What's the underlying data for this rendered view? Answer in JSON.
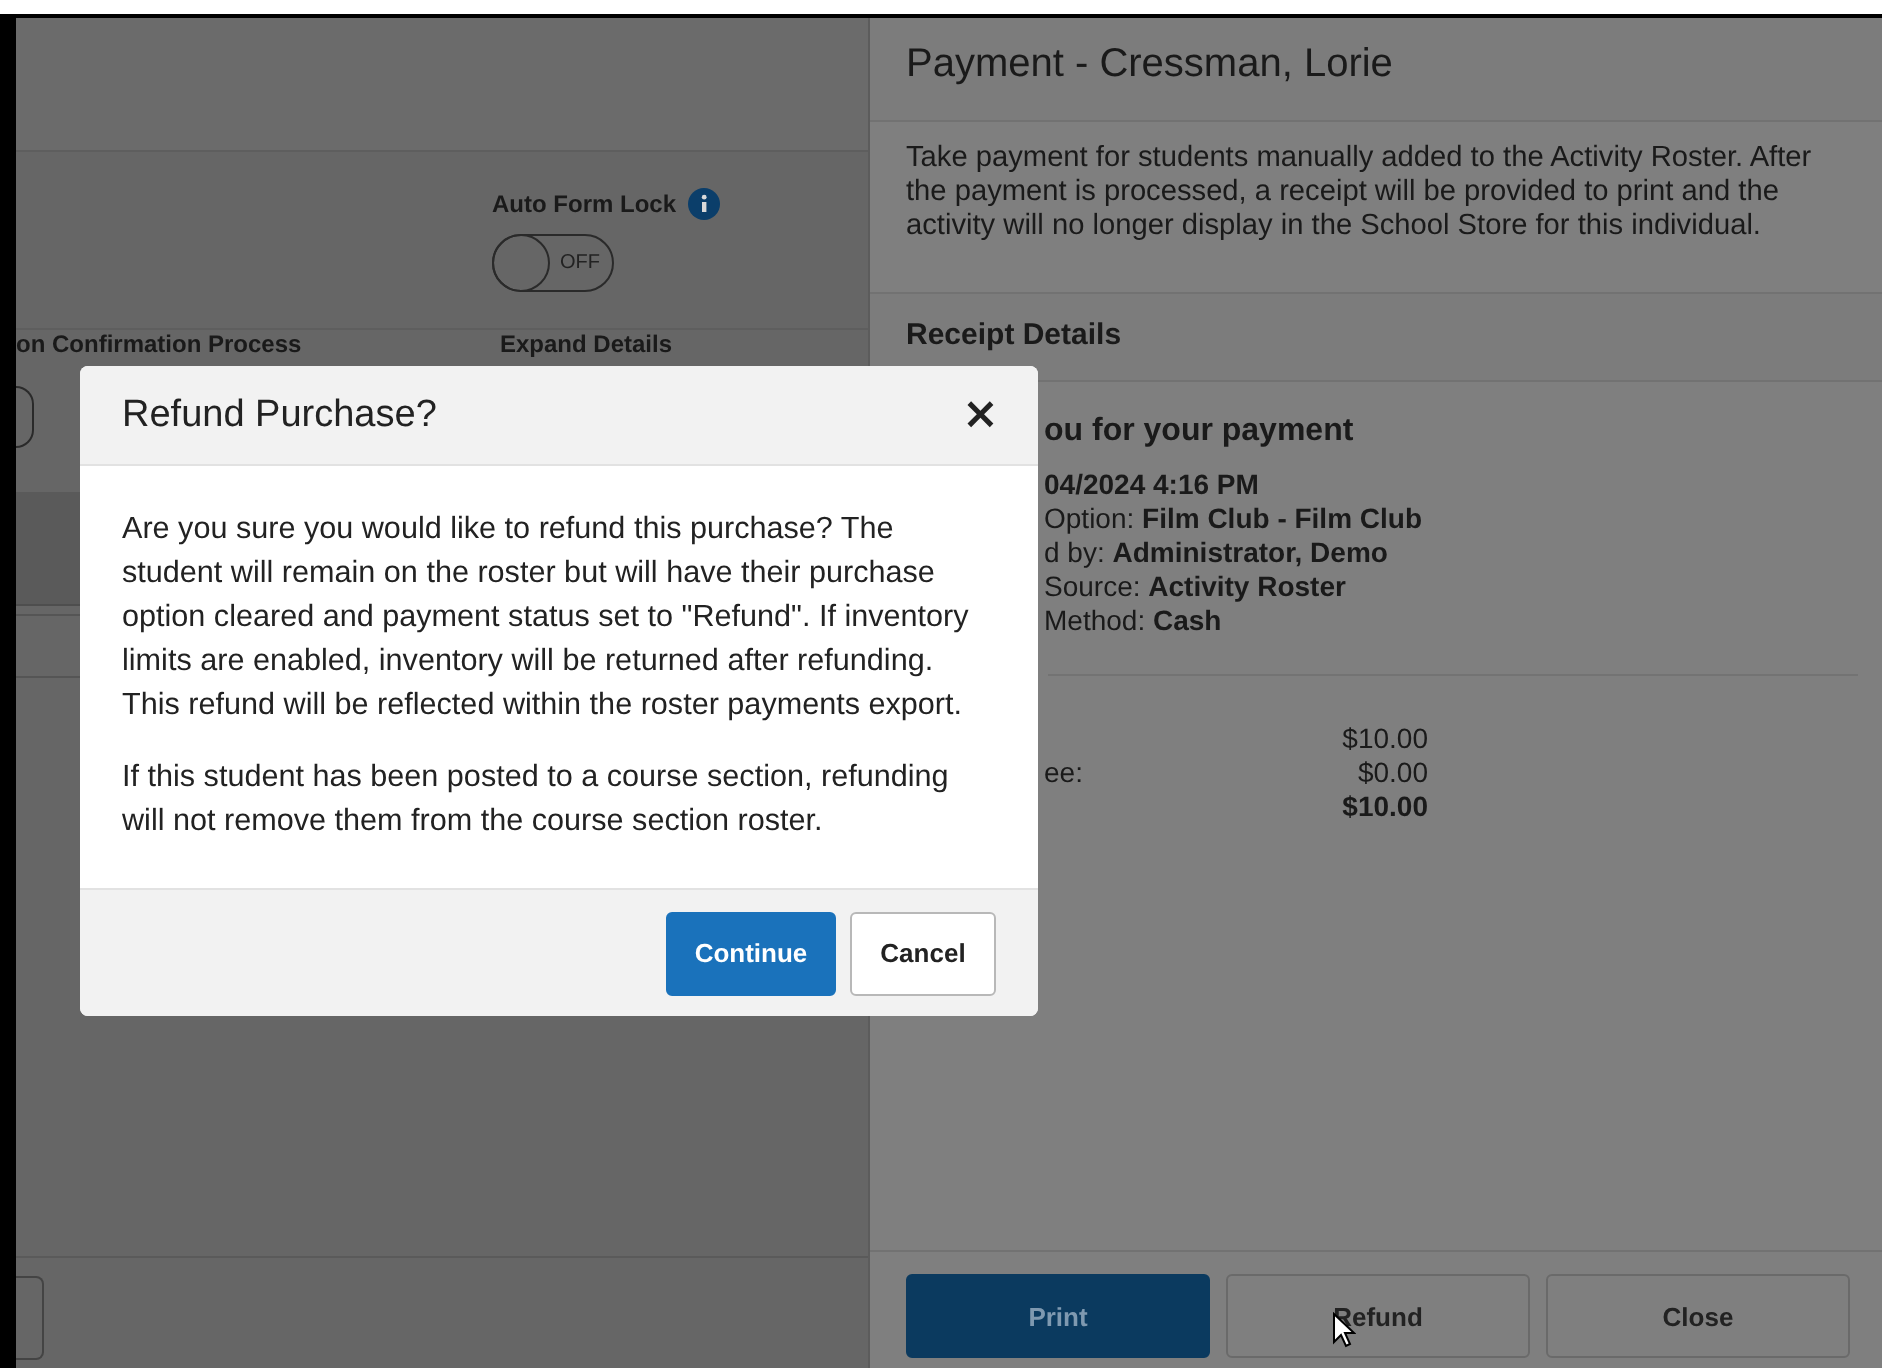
{
  "background_page": {
    "auto_form_lock": {
      "label": "Auto Form Lock",
      "toggle": {
        "on": false,
        "label": "OFF"
      }
    },
    "column_labels": [
      "on Confirmation Process",
      "Expand Details"
    ],
    "partial_toggle": {
      "on": false
    }
  },
  "payment_panel": {
    "title": "Payment - Cressman, Lorie",
    "description": "Take payment for students manually added to the Activity Roster. After the payment is processed, a receipt will be provided to print and the activity will no longer display in the School Store for this individual.",
    "section_title": "Receipt Details",
    "receipt": {
      "heading": "ou for your payment",
      "date": "04/2024 4:16 PM",
      "lines": [
        {
          "label": "Option:",
          "value": "Film Club - Film Club"
        },
        {
          "label": "d by:",
          "value": "Administrator, Demo"
        },
        {
          "label": "Source:",
          "value": "Activity Roster"
        },
        {
          "label": "Method:",
          "value": "Cash"
        }
      ],
      "amounts": [
        {
          "value": "$10.00",
          "bold": false
        },
        {
          "label": "ee:",
          "value": "$0.00",
          "bold": false
        },
        {
          "value": "$10.00",
          "bold": true
        }
      ]
    },
    "buttons": [
      {
        "label": "Print",
        "kind": "primary"
      },
      {
        "label": "Refund",
        "kind": "secondary"
      },
      {
        "label": "Close",
        "kind": "secondary"
      }
    ]
  },
  "dialog": {
    "title": "Refund Purchase?",
    "close": "×",
    "paragraphs": [
      "Are you sure you would like to refund this purchase? The student will remain on the roster but will have their purchase option cleared and payment status set to \"Refund\". If inventory limits are enabled, inventory will be returned after refunding. This refund will be reflected within the roster payments export.",
      "If this student has been posted to a course section, refunding will not remove them from the course section roster."
    ],
    "buttons": [
      {
        "label": "Continue",
        "kind": "primary"
      },
      {
        "label": "Cancel",
        "kind": "secondary"
      }
    ]
  }
}
